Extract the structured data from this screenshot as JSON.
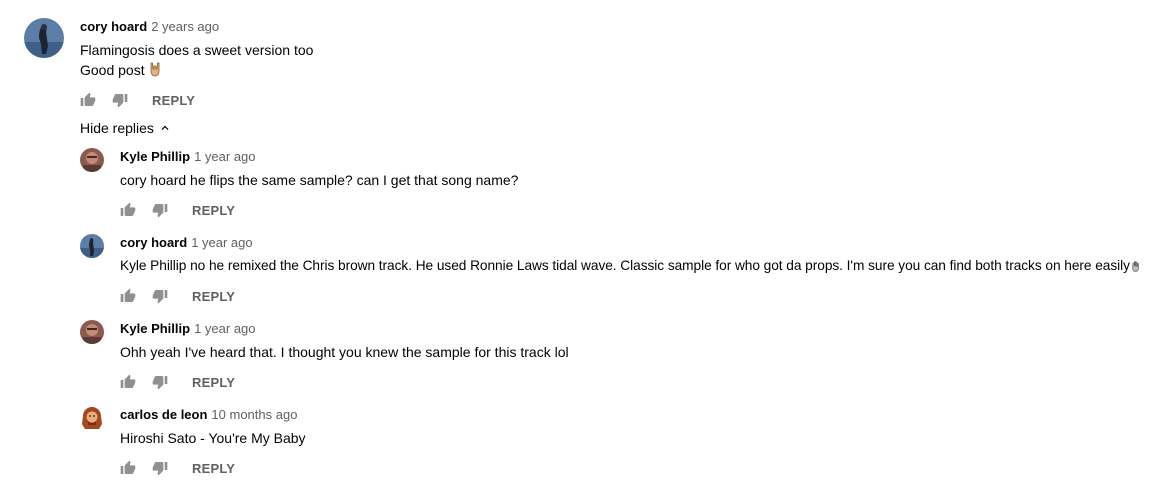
{
  "top_comment": {
    "author": "cory hoard",
    "time": "2 years ago",
    "line1": "Flamingosis does a sweet version too",
    "line2": "Good post",
    "line2_emoji_icon": "horns-hand-emoji-icon",
    "reply_label": "REPLY"
  },
  "hide_replies_label": "Hide replies",
  "replies": [
    {
      "author": "Kyle Phillip",
      "time": "1 year ago",
      "text": "cory hoard he flips the same sample? can I get that song name?",
      "reply_label": "REPLY",
      "avatar_icon": "kyle-avatar"
    },
    {
      "author": "cory hoard",
      "time": "1 year ago",
      "text": "Kyle Phillip no he remixed the Chris brown track. He used Ronnie Laws tidal wave. Classic sample for who got da props. I'm sure you can find both tracks on here easily",
      "trailing_emoji_icon": "hand-emoji-icon",
      "reply_label": "REPLY",
      "avatar_icon": "cory-avatar"
    },
    {
      "author": "Kyle Phillip",
      "time": "1 year ago",
      "text": "Ohh yeah I've heard that. I thought you knew the sample for this track lol",
      "reply_label": "REPLY",
      "avatar_icon": "kyle-avatar"
    },
    {
      "author": "carlos de leon",
      "time": "10 months ago",
      "text": "Hiroshi Sato - You're My Baby",
      "reply_label": "REPLY",
      "avatar_icon": "carlos-avatar"
    }
  ]
}
